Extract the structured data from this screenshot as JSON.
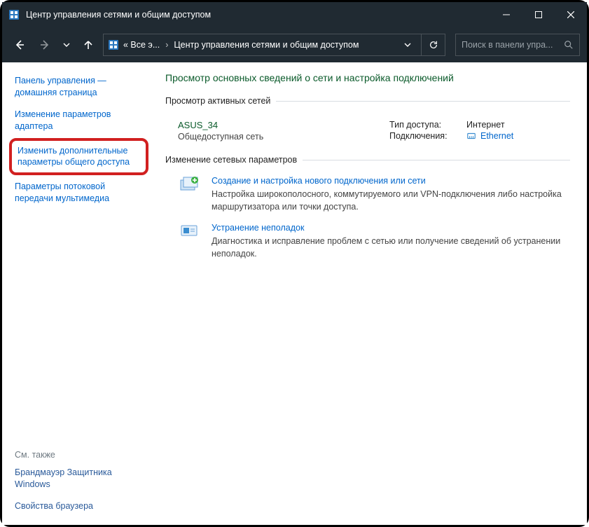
{
  "titlebar": {
    "title": "Центр управления сетями и общим доступом"
  },
  "addressbar": {
    "crumb1": "« Все э...",
    "crumb2": "Центр управления сетями и общим доступом",
    "search_placeholder": "Поиск в панели упра..."
  },
  "sidebar": {
    "home": "Панель управления — домашняя страница",
    "adapter": "Изменение параметров адаптера",
    "advanced": "Изменить дополнительные параметры общего доступа",
    "streaming": "Параметры потоковой передачи мультимедиа",
    "see_also": "См. также",
    "firewall": "Брандмауэр Защитника Windows",
    "browser": "Свойства браузера"
  },
  "main": {
    "heading": "Просмотр основных сведений о сети и настройка подключений",
    "active_label": "Просмотр активных сетей",
    "net_name": "ASUS_34",
    "net_type": "Общедоступная сеть",
    "access_label": "Тип доступа:",
    "access_value": "Интернет",
    "conn_label": "Подключения:",
    "conn_value": "Ethernet",
    "change_label": "Изменение сетевых параметров",
    "task1_title": "Создание и настройка нового подключения или сети",
    "task1_desc": "Настройка широкополосного, коммутируемого или VPN-подключения либо настройка маршрутизатора или точки доступа.",
    "task2_title": "Устранение неполадок",
    "task2_desc": "Диагностика и исправление проблем с сетью или получение сведений об устранении неполадок."
  }
}
